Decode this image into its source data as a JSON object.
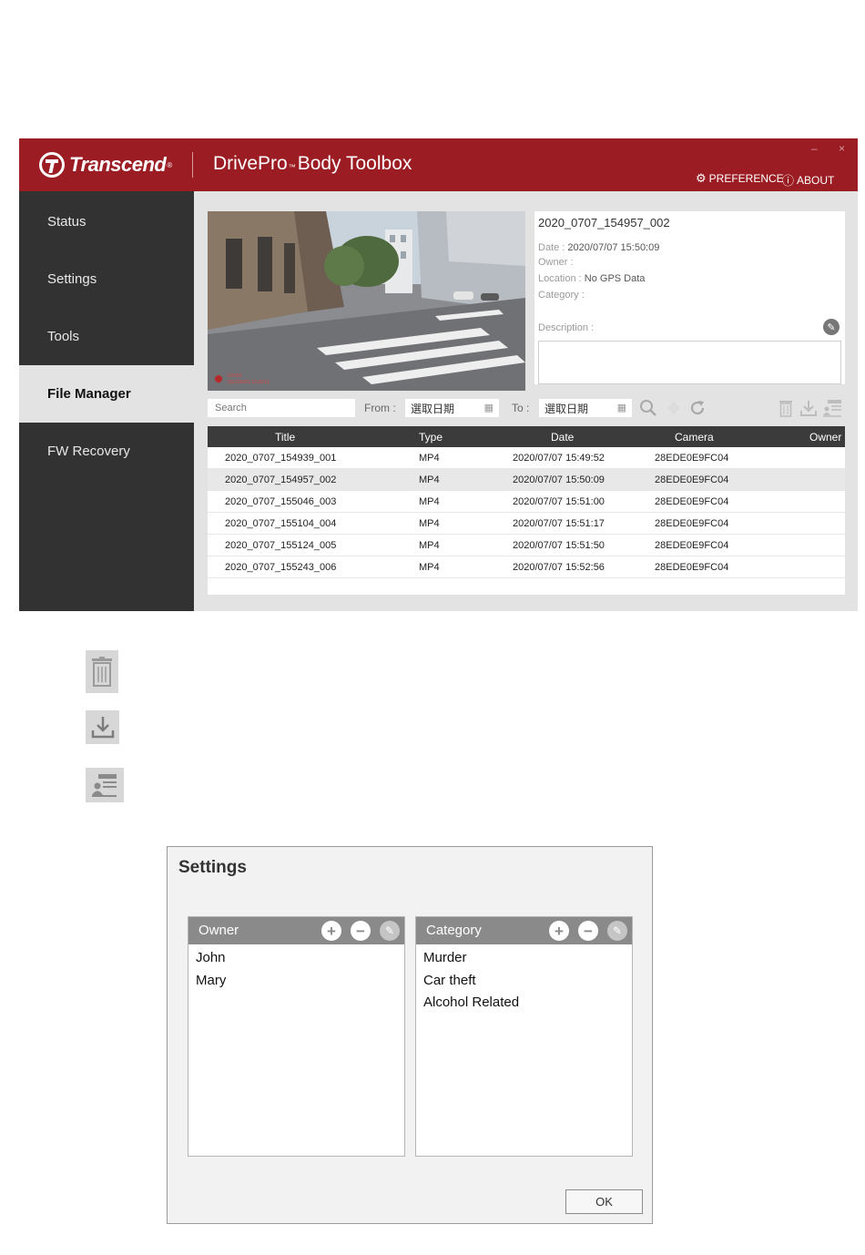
{
  "app": {
    "brand": "Transcend",
    "brand_reg": "®",
    "title_part1": "DrivePro",
    "title_tm": "™",
    "title_part2": "Body Toolbox",
    "minimize": "–",
    "close": "×",
    "preference_label": "PREFERENCE",
    "about_label": "ABOUT"
  },
  "sidebar": {
    "items": [
      {
        "label": "Status"
      },
      {
        "label": "Settings"
      },
      {
        "label": "Tools"
      },
      {
        "label": "File Manager"
      },
      {
        "label": "FW Recovery"
      }
    ],
    "active_index": 3
  },
  "info": {
    "title": "2020_0707_154957_002",
    "date_label": "Date :",
    "date_value": "2020/07/07 15:50:09",
    "owner_label": "Owner :",
    "owner_value": "",
    "location_label": "Location :",
    "location_value": "No GPS Data",
    "category_label": "Category :",
    "category_value": "",
    "description_label": "Description :"
  },
  "preview": {
    "overlay_line1": "DP320",
    "overlay_line2": "2017/06/21 14:20:11"
  },
  "filter": {
    "search_placeholder": "Search",
    "from_label": "From :",
    "from_value": "選取日期",
    "to_label": "To :",
    "to_value": "選取日期"
  },
  "table": {
    "headers": [
      "Title",
      "Type",
      "Date",
      "Camera",
      "Owner"
    ],
    "rows": [
      {
        "title": "2020_0707_154939_001",
        "type": "MP4",
        "date": "2020/07/07 15:49:52",
        "camera": "28EDE0E9FC04",
        "owner": ""
      },
      {
        "title": "2020_0707_154957_002",
        "type": "MP4",
        "date": "2020/07/07 15:50:09",
        "camera": "28EDE0E9FC04",
        "owner": ""
      },
      {
        "title": "2020_0707_155046_003",
        "type": "MP4",
        "date": "2020/07/07 15:51:00",
        "camera": "28EDE0E9FC04",
        "owner": ""
      },
      {
        "title": "2020_0707_155104_004",
        "type": "MP4",
        "date": "2020/07/07 15:51:17",
        "camera": "28EDE0E9FC04",
        "owner": ""
      },
      {
        "title": "2020_0707_155124_005",
        "type": "MP4",
        "date": "2020/07/07 15:51:50",
        "camera": "28EDE0E9FC04",
        "owner": ""
      },
      {
        "title": "2020_0707_155243_006",
        "type": "MP4",
        "date": "2020/07/07 15:52:56",
        "camera": "28EDE0E9FC04",
        "owner": ""
      }
    ],
    "selected_index": 1
  },
  "icons": [
    "trash-icon",
    "download-icon",
    "id-card-icon",
    "search-icon",
    "refresh-icon",
    "diamond-icon",
    "calendar-icon",
    "pencil-icon",
    "gear-icon",
    "info-icon",
    "plus-icon",
    "minus-icon"
  ],
  "colors": {
    "brand_red": "#9b1c22",
    "sidebar_dark": "#323232",
    "content_gray": "#e3e3e3",
    "table_header": "#3b3b3b",
    "list_header": "#8a8a8a"
  },
  "settings_dialog": {
    "title": "Settings",
    "owner_header": "Owner",
    "owners": [
      "John",
      "Mary"
    ],
    "category_header": "Category",
    "categories": [
      "Murder",
      "Car theft",
      "Alcohol Related"
    ],
    "ok_label": "OK"
  }
}
